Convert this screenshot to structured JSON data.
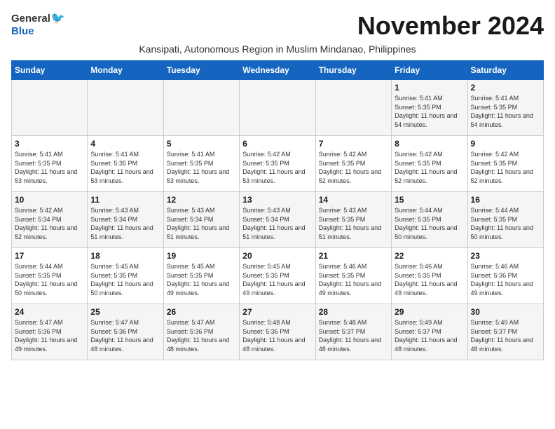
{
  "header": {
    "logo": {
      "general": "General",
      "blue": "Blue"
    },
    "month_year": "November 2024",
    "subtitle": "Kansipati, Autonomous Region in Muslim Mindanao, Philippines"
  },
  "weekdays": [
    "Sunday",
    "Monday",
    "Tuesday",
    "Wednesday",
    "Thursday",
    "Friday",
    "Saturday"
  ],
  "weeks": [
    [
      {
        "day": "",
        "sunrise": "",
        "sunset": "",
        "daylight": ""
      },
      {
        "day": "",
        "sunrise": "",
        "sunset": "",
        "daylight": ""
      },
      {
        "day": "",
        "sunrise": "",
        "sunset": "",
        "daylight": ""
      },
      {
        "day": "",
        "sunrise": "",
        "sunset": "",
        "daylight": ""
      },
      {
        "day": "",
        "sunrise": "",
        "sunset": "",
        "daylight": ""
      },
      {
        "day": "1",
        "sunrise": "Sunrise: 5:41 AM",
        "sunset": "Sunset: 5:35 PM",
        "daylight": "Daylight: 11 hours and 54 minutes."
      },
      {
        "day": "2",
        "sunrise": "Sunrise: 5:41 AM",
        "sunset": "Sunset: 5:35 PM",
        "daylight": "Daylight: 11 hours and 54 minutes."
      }
    ],
    [
      {
        "day": "3",
        "sunrise": "Sunrise: 5:41 AM",
        "sunset": "Sunset: 5:35 PM",
        "daylight": "Daylight: 11 hours and 53 minutes."
      },
      {
        "day": "4",
        "sunrise": "Sunrise: 5:41 AM",
        "sunset": "Sunset: 5:35 PM",
        "daylight": "Daylight: 11 hours and 53 minutes."
      },
      {
        "day": "5",
        "sunrise": "Sunrise: 5:41 AM",
        "sunset": "Sunset: 5:35 PM",
        "daylight": "Daylight: 11 hours and 53 minutes."
      },
      {
        "day": "6",
        "sunrise": "Sunrise: 5:42 AM",
        "sunset": "Sunset: 5:35 PM",
        "daylight": "Daylight: 11 hours and 53 minutes."
      },
      {
        "day": "7",
        "sunrise": "Sunrise: 5:42 AM",
        "sunset": "Sunset: 5:35 PM",
        "daylight": "Daylight: 11 hours and 52 minutes."
      },
      {
        "day": "8",
        "sunrise": "Sunrise: 5:42 AM",
        "sunset": "Sunset: 5:35 PM",
        "daylight": "Daylight: 11 hours and 52 minutes."
      },
      {
        "day": "9",
        "sunrise": "Sunrise: 5:42 AM",
        "sunset": "Sunset: 5:35 PM",
        "daylight": "Daylight: 11 hours and 52 minutes."
      }
    ],
    [
      {
        "day": "10",
        "sunrise": "Sunrise: 5:42 AM",
        "sunset": "Sunset: 5:34 PM",
        "daylight": "Daylight: 11 hours and 52 minutes."
      },
      {
        "day": "11",
        "sunrise": "Sunrise: 5:43 AM",
        "sunset": "Sunset: 5:34 PM",
        "daylight": "Daylight: 11 hours and 51 minutes."
      },
      {
        "day": "12",
        "sunrise": "Sunrise: 5:43 AM",
        "sunset": "Sunset: 5:34 PM",
        "daylight": "Daylight: 11 hours and 51 minutes."
      },
      {
        "day": "13",
        "sunrise": "Sunrise: 5:43 AM",
        "sunset": "Sunset: 5:34 PM",
        "daylight": "Daylight: 11 hours and 51 minutes."
      },
      {
        "day": "14",
        "sunrise": "Sunrise: 5:43 AM",
        "sunset": "Sunset: 5:35 PM",
        "daylight": "Daylight: 11 hours and 51 minutes."
      },
      {
        "day": "15",
        "sunrise": "Sunrise: 5:44 AM",
        "sunset": "Sunset: 5:35 PM",
        "daylight": "Daylight: 11 hours and 50 minutes."
      },
      {
        "day": "16",
        "sunrise": "Sunrise: 5:44 AM",
        "sunset": "Sunset: 5:35 PM",
        "daylight": "Daylight: 11 hours and 50 minutes."
      }
    ],
    [
      {
        "day": "17",
        "sunrise": "Sunrise: 5:44 AM",
        "sunset": "Sunset: 5:35 PM",
        "daylight": "Daylight: 11 hours and 50 minutes."
      },
      {
        "day": "18",
        "sunrise": "Sunrise: 5:45 AM",
        "sunset": "Sunset: 5:35 PM",
        "daylight": "Daylight: 11 hours and 50 minutes."
      },
      {
        "day": "19",
        "sunrise": "Sunrise: 5:45 AM",
        "sunset": "Sunset: 5:35 PM",
        "daylight": "Daylight: 11 hours and 49 minutes."
      },
      {
        "day": "20",
        "sunrise": "Sunrise: 5:45 AM",
        "sunset": "Sunset: 5:35 PM",
        "daylight": "Daylight: 11 hours and 49 minutes."
      },
      {
        "day": "21",
        "sunrise": "Sunrise: 5:46 AM",
        "sunset": "Sunset: 5:35 PM",
        "daylight": "Daylight: 11 hours and 49 minutes."
      },
      {
        "day": "22",
        "sunrise": "Sunrise: 5:46 AM",
        "sunset": "Sunset: 5:35 PM",
        "daylight": "Daylight: 11 hours and 49 minutes."
      },
      {
        "day": "23",
        "sunrise": "Sunrise: 5:46 AM",
        "sunset": "Sunset: 5:36 PM",
        "daylight": "Daylight: 11 hours and 49 minutes."
      }
    ],
    [
      {
        "day": "24",
        "sunrise": "Sunrise: 5:47 AM",
        "sunset": "Sunset: 5:36 PM",
        "daylight": "Daylight: 11 hours and 49 minutes."
      },
      {
        "day": "25",
        "sunrise": "Sunrise: 5:47 AM",
        "sunset": "Sunset: 5:36 PM",
        "daylight": "Daylight: 11 hours and 48 minutes."
      },
      {
        "day": "26",
        "sunrise": "Sunrise: 5:47 AM",
        "sunset": "Sunset: 5:36 PM",
        "daylight": "Daylight: 11 hours and 48 minutes."
      },
      {
        "day": "27",
        "sunrise": "Sunrise: 5:48 AM",
        "sunset": "Sunset: 5:36 PM",
        "daylight": "Daylight: 11 hours and 48 minutes."
      },
      {
        "day": "28",
        "sunrise": "Sunrise: 5:48 AM",
        "sunset": "Sunset: 5:37 PM",
        "daylight": "Daylight: 11 hours and 48 minutes."
      },
      {
        "day": "29",
        "sunrise": "Sunrise: 5:49 AM",
        "sunset": "Sunset: 5:37 PM",
        "daylight": "Daylight: 11 hours and 48 minutes."
      },
      {
        "day": "30",
        "sunrise": "Sunrise: 5:49 AM",
        "sunset": "Sunset: 5:37 PM",
        "daylight": "Daylight: 11 hours and 48 minutes."
      }
    ]
  ]
}
